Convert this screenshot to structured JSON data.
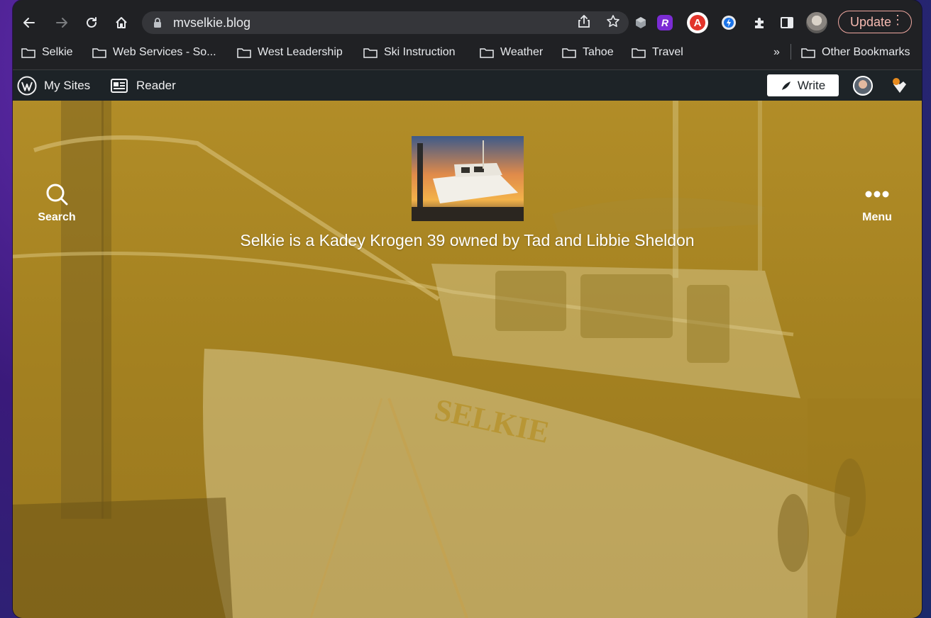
{
  "browser": {
    "url": "mvselkie.blog",
    "update_label": "Update",
    "more_glyph": "⋮",
    "bookmarks_overflow": "»",
    "bookmarks": [
      {
        "label": "Selkie"
      },
      {
        "label": "Web Services - So..."
      },
      {
        "label": "West Leadership"
      },
      {
        "label": "Ski Instruction"
      },
      {
        "label": "Weather"
      },
      {
        "label": "Tahoe"
      },
      {
        "label": "Travel"
      }
    ],
    "other_bookmarks": "Other Bookmarks",
    "accent_update": "#f6b9b0"
  },
  "wpbar": {
    "my_sites": "My Sites",
    "reader": "Reader",
    "write": "Write"
  },
  "site": {
    "tagline": "Selkie is a Kadey Krogen 39 owned by Tad and Libbie Sheldon",
    "search_label": "Search",
    "menu_label": "Menu",
    "boat_name": "SELKIE",
    "overlay_color": "#b8922a"
  },
  "extensions": [
    {
      "name": "shield-ext-icon"
    },
    {
      "name": "r-ext-icon",
      "glyph": "R"
    },
    {
      "name": "a-ext-icon",
      "glyph": "A"
    },
    {
      "name": "lightning-ext-icon"
    },
    {
      "name": "puzzle-icon"
    },
    {
      "name": "sidepanel-icon"
    },
    {
      "name": "profile-avatar"
    }
  ]
}
